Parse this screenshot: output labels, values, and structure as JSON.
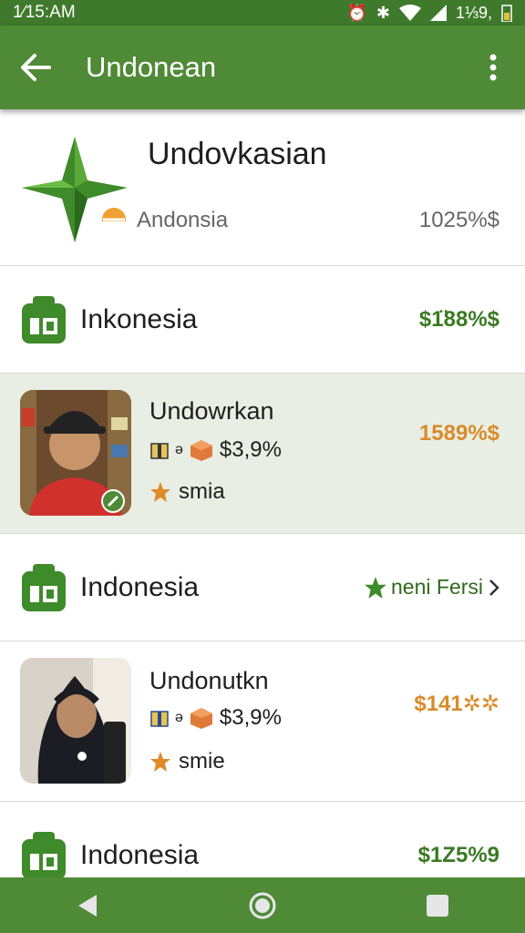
{
  "status": {
    "time": "1⁄15:AM",
    "right": "1⅓9,"
  },
  "appbar": {
    "title": "Undonean",
    "back_icon": "arrow-back-icon",
    "menu_icon": "more-vert-icon"
  },
  "header": {
    "title": "Undovkasian",
    "subtitle": "Andonsia",
    "value": "1025%$"
  },
  "rows": [
    {
      "label": "Inkonesia",
      "price": "$1̈88%$"
    },
    {
      "name": "Undowrkan",
      "meta_value": "$3,9%",
      "rating_label": "smia",
      "price": "1589%$"
    },
    {
      "label": "Indonesia",
      "badge": "neni Fersi"
    },
    {
      "name": "Undonutkn",
      "meta_value": "$3,9%",
      "rating_label": "smie",
      "price": "$141✲✲"
    },
    {
      "label": "Indonesia",
      "price": "$1Z5%9"
    }
  ],
  "colors": {
    "primary": "#4f8a36",
    "status": "#3f7a2c",
    "accent": "#d98b2a",
    "green_text": "#3a7a22"
  }
}
